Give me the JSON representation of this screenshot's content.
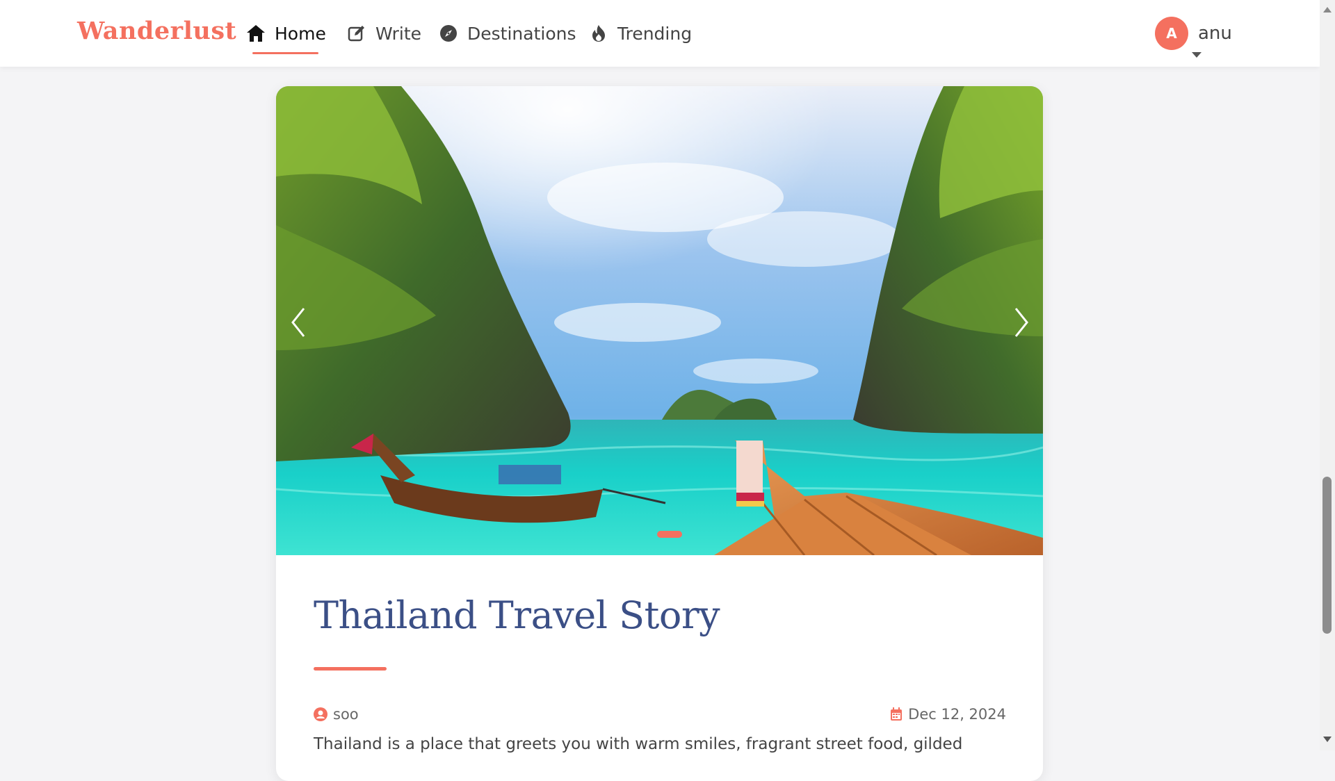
{
  "brand": "Wanderlust",
  "nav": {
    "items": [
      {
        "label": "Home",
        "icon": "home-icon",
        "active": true
      },
      {
        "label": "Write",
        "icon": "edit-icon",
        "active": false
      },
      {
        "label": "Destinations",
        "icon": "compass-icon",
        "active": false
      },
      {
        "label": "Trending",
        "icon": "fire-icon",
        "active": false
      }
    ]
  },
  "user": {
    "initial": "A",
    "name": "anu"
  },
  "post": {
    "title": "Thailand Travel Story",
    "author": "soo",
    "date": "Dec 12, 2024",
    "excerpt": "Thailand is a place that greets you with warm smiles, fragrant street food, gilded"
  },
  "colors": {
    "accent": "#f4705f",
    "title": "#3b4f86"
  }
}
